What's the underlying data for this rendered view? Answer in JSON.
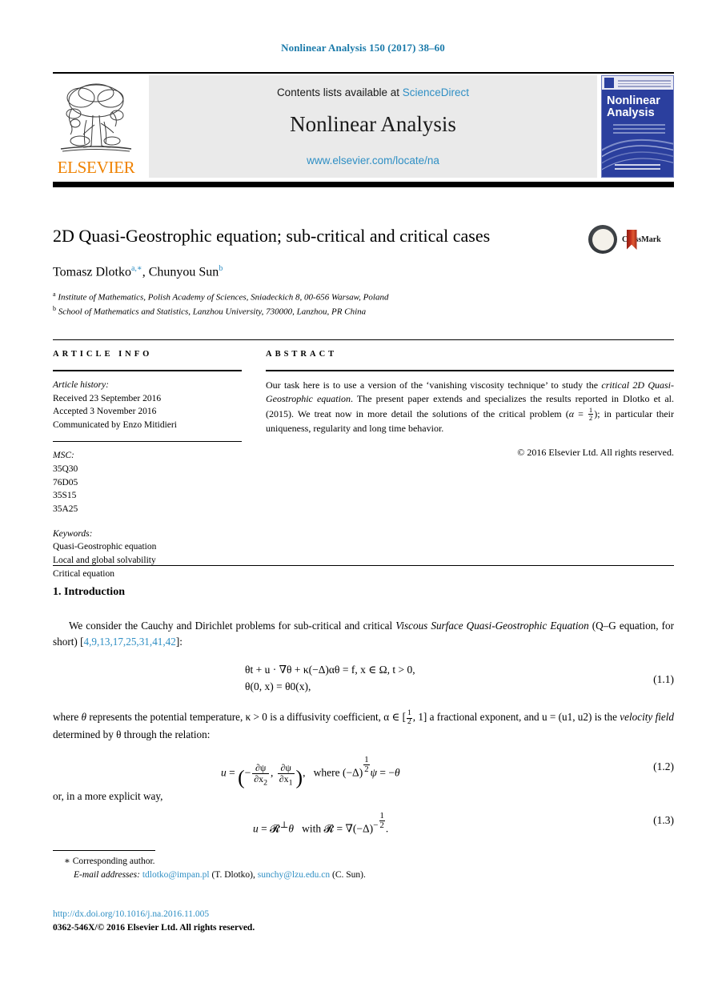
{
  "running_head": "Nonlinear Analysis 150 (2017) 38–60",
  "masthead": {
    "publisher": "ELSEVIER",
    "contents_prefix": "Contents lists available at ",
    "contents_link": "ScienceDirect",
    "journal_title": "Nonlinear Analysis",
    "journal_url": "www.elsevier.com/locate/na",
    "cover_title": "Nonlinear Analysis"
  },
  "article": {
    "title": "2D Quasi-Geostrophic equation; sub-critical and critical cases",
    "crossmark_label": "CrossMark",
    "authors": "Tomasz Dlotko, Chunyou Sun",
    "author_marks": {
      "a1": "a,∗",
      "a2": "b"
    },
    "affiliations": [
      {
        "mark": "a",
        "text": "Institute of Mathematics, Polish Academy of Sciences, Sniadeckich 8, 00-656 Warsaw, Poland"
      },
      {
        "mark": "b",
        "text": "School of Mathematics and Statistics, Lanzhou University, 730000, Lanzhou, PR China"
      }
    ]
  },
  "info": {
    "heading": "ARTICLE INFO",
    "history_label": "Article history:",
    "history": [
      "Received 23 September 2016",
      "Accepted 3 November 2016",
      "Communicated by Enzo Mitidieri"
    ],
    "msc_label": "MSC:",
    "msc": [
      "35Q30",
      "76D05",
      "35S15",
      "35A25"
    ],
    "keywords_label": "Keywords:",
    "keywords": [
      "Quasi-Geostrophic equation",
      "Local and global solvability",
      "Critical equation"
    ]
  },
  "abstract": {
    "heading": "ABSTRACT",
    "part1": "Our task here is to use a version of the ‘vanishing viscosity technique’ to study the ",
    "italic1": "critical 2D Quasi-Geostrophic equation",
    "part2": ". The present paper extends and specializes the results reported in Dlotko et al. (2015). We treat now in more detail the solutions of the critical problem (",
    "part3": "); in particular their uniqueness, regularity and long time behavior.",
    "copyright": "© 2016 Elsevier Ltd. All rights reserved."
  },
  "body": {
    "section_heading": "1. Introduction",
    "p1_a": "We consider the Cauchy and Dirichlet problems for sub-critical and critical ",
    "p1_italic": "Viscous Surface Quasi-Geostrophic Equation",
    "p1_b": " (Q–G equation, for short) [",
    "p1_cites": "4,9,13,17,25,31,41,42",
    "p1_c": "]:",
    "eq1_line1": "θt + u · ∇θ + κ(−Δ)αθ = f,    x ∈ Ω, t > 0,",
    "eq1_line2": "θ(0, x) = θ0(x),",
    "eq1_num": "(1.1)",
    "p2_a": "where ",
    "p2_b": " represents the potential temperature, κ > 0 is a diffusivity coefficient, α ∈ [",
    "p2_c": ", 1] a fractional exponent, and u = (u1, u2) is the ",
    "p2_italic": "velocity field",
    "p2_d": " determined by θ through the relation:",
    "eq2_num": "(1.2)",
    "eq2_where": "where",
    "p3": "or, in a more explicit way,",
    "eq3_num": "(1.3)",
    "eq3_with": "with"
  },
  "footer": {
    "corresponding": "Corresponding author.",
    "email_label": "E-mail addresses:",
    "email1": "tdlotko@impan.pl",
    "email1_owner": "(T. Dlotko),",
    "email2": "sunchy@lzu.edu.cn",
    "email2_owner": "(C. Sun).",
    "doi": "http://dx.doi.org/10.1016/j.na.2016.11.005",
    "issn": "0362-546X/© 2016 Elsevier Ltd. All rights reserved."
  },
  "colors": {
    "link_blue": "#2f8fc4",
    "head_blue": "#1a7aaa",
    "elsevier_orange": "#ef8200",
    "cover_blue": "#2b3f9e"
  }
}
